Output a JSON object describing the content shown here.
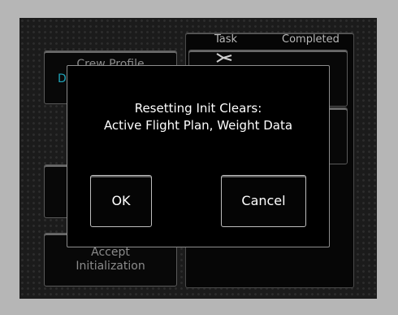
{
  "task_panel": {
    "header_task": "Task",
    "header_completed": "Completed"
  },
  "left_buttons": {
    "crew_profile": "Crew Profile",
    "crew_profile_value_partial": "D",
    "accept_line1": "Accept",
    "accept_line2": "Initialization"
  },
  "dialog": {
    "message_line1": "Resetting Init Clears:",
    "message_line2": "Active Flight Plan, Weight Data",
    "ok_label": "OK",
    "cancel_label": "Cancel"
  },
  "icons": {
    "task_icon": "aircraft-icon"
  }
}
